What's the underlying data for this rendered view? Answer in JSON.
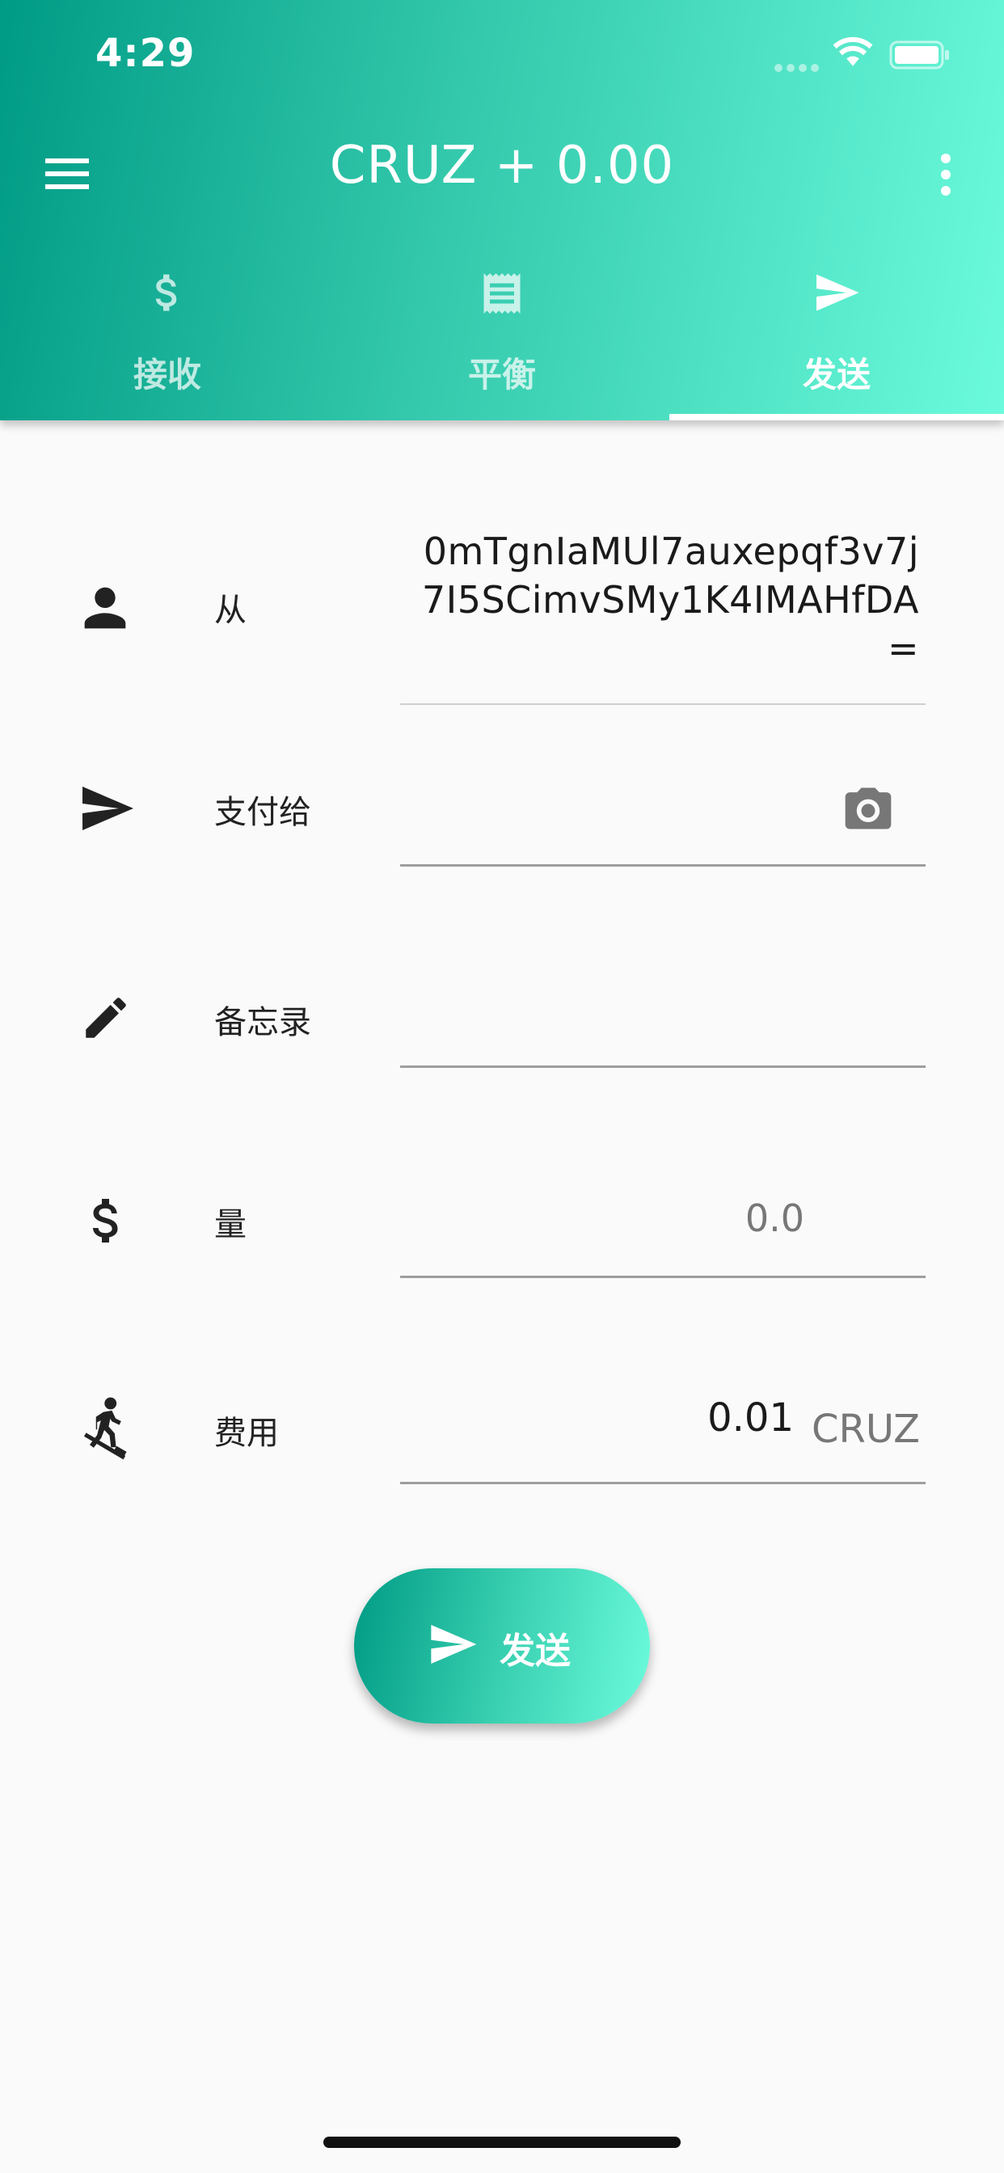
{
  "status_bar": {
    "time": "4:29"
  },
  "header": {
    "title": "CRUZ + 0.00",
    "menu_icon": "hamburger-menu-icon",
    "more_icon": "more-vert-icon"
  },
  "tabs": [
    {
      "label": "接收",
      "icon": "dollar-icon",
      "active": false
    },
    {
      "label": "平衡",
      "icon": "receipt-icon",
      "active": false
    },
    {
      "label": "发送",
      "icon": "send-icon",
      "active": true
    }
  ],
  "form": {
    "from": {
      "label": "从",
      "icon": "person-icon",
      "value": "0mTgnIaMUl7auxepqf3v7j7I5SCimvSMy1K4IMAHfDA="
    },
    "pay_to": {
      "label": "支付给",
      "icon": "send-icon",
      "value": "",
      "camera_icon": "camera-icon"
    },
    "memo": {
      "label": "备忘录",
      "icon": "pencil-icon",
      "value": ""
    },
    "amount": {
      "label": "量",
      "icon": "dollar-icon",
      "placeholder": "0.0"
    },
    "fee": {
      "label": "费用",
      "icon": "hiking-icon",
      "value": "0.01",
      "unit": "CRUZ"
    }
  },
  "send_button": {
    "label": "发送",
    "icon": "send-icon"
  },
  "colors": {
    "gradient_start": "#009b85",
    "gradient_end": "#6bfbdc",
    "background": "#fafafa"
  }
}
